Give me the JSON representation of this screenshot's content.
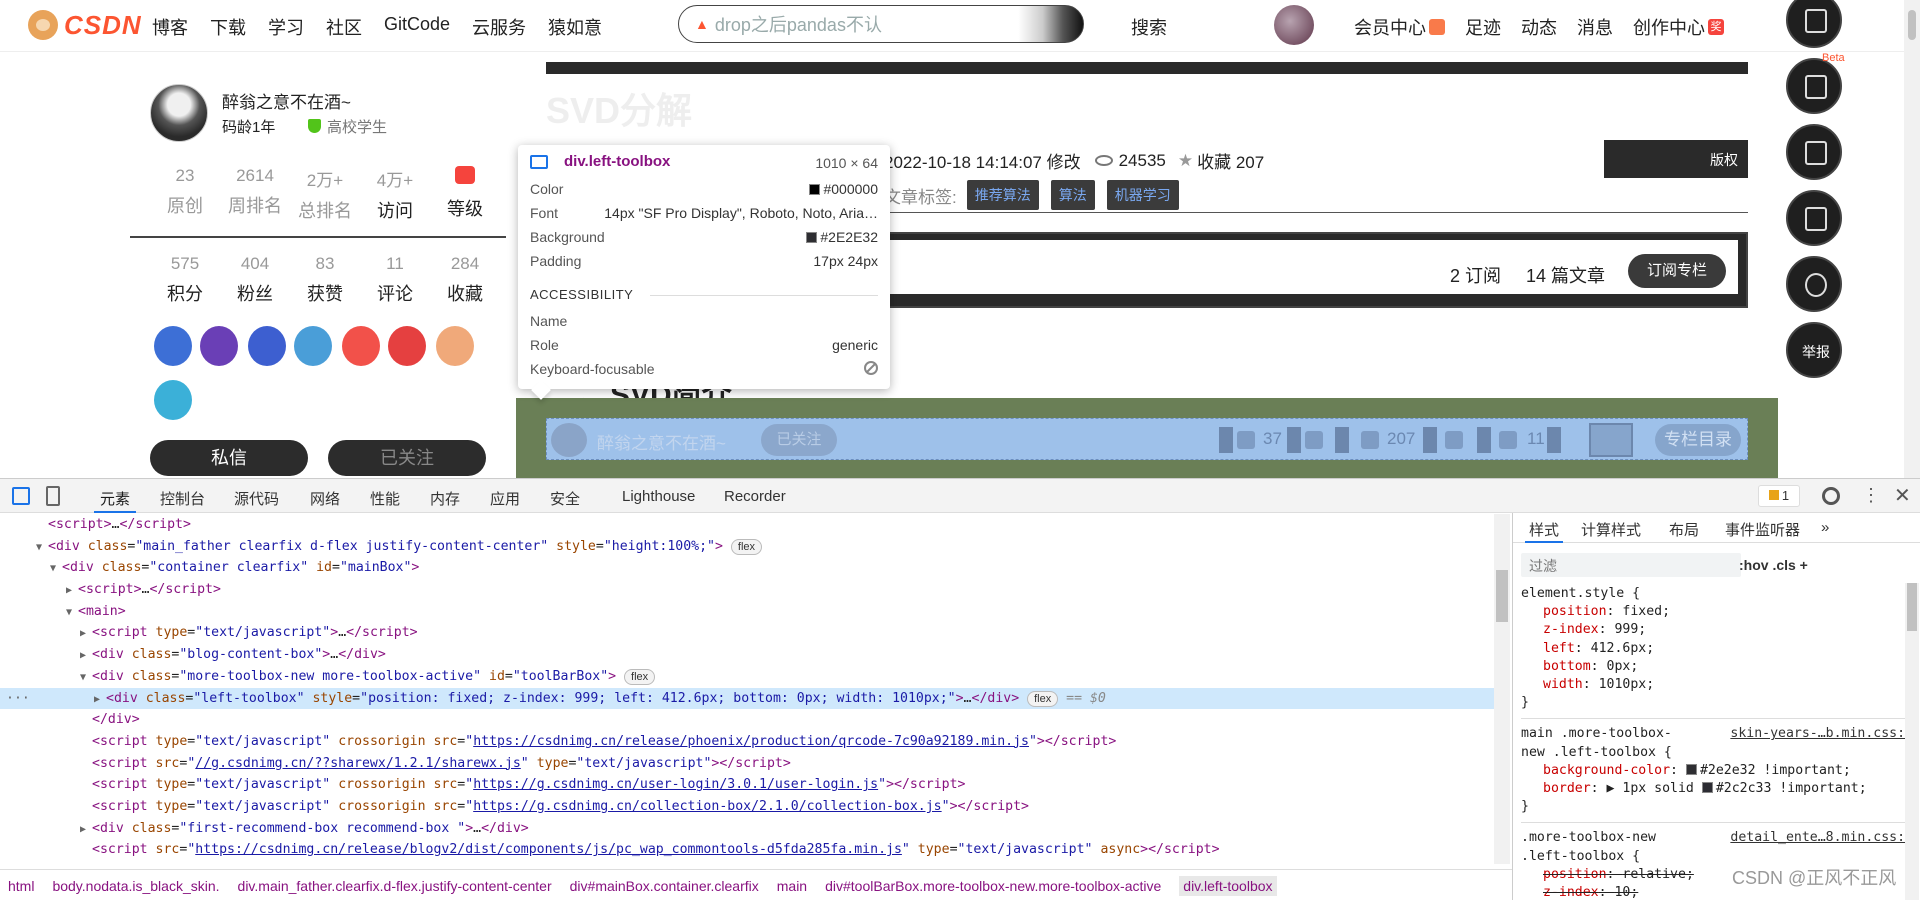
{
  "nav": {
    "logo_text": "CSDN",
    "links": [
      "博客",
      "下载",
      "学习",
      "社区",
      "GitCode",
      "云服务",
      "猿如意"
    ],
    "search_placeholder": "drop之后pandas不认",
    "search_button": "搜索",
    "right_links": [
      "会员中心",
      "足迹",
      "动态",
      "消息",
      "创作中心"
    ]
  },
  "right_tools": {
    "beta_label": "Beta",
    "report_label": "举报"
  },
  "sidebar": {
    "username": "醉翁之意不在酒~",
    "code_age": "码龄1年",
    "school": "高校学生",
    "stats_row1": [
      {
        "num": "23",
        "label": "原创"
      },
      {
        "num": "2614",
        "label": "周排名"
      },
      {
        "num": "2万+",
        "label": "总排名"
      },
      {
        "num": "4万+",
        "label": "访问"
      },
      {
        "num": "",
        "label": "等级"
      }
    ],
    "stats_row2": [
      {
        "num": "575",
        "label": "积分"
      },
      {
        "num": "404",
        "label": "粉丝"
      },
      {
        "num": "83",
        "label": "获赞"
      },
      {
        "num": "11",
        "label": "评论"
      },
      {
        "num": "284",
        "label": "收藏"
      }
    ],
    "badge_colors": [
      "#3d6fd6",
      "#6a3fb6",
      "#3d5fd0",
      "#4a9ed8",
      "#f2514a",
      "#e54040",
      "#f0a97a",
      "#3bb0d8"
    ],
    "message_button": "私信",
    "follow_button": "已关注"
  },
  "article": {
    "title": "SVD分解",
    "modified": "2022-10-18 14:14:07 修改",
    "views": "24535",
    "favorites": "收藏 207",
    "copyright": "版权",
    "tags_label": "文章标签:",
    "tags": [
      "推荐算法",
      "算法",
      "机器学习"
    ],
    "column_subscribe_count": "2 订阅",
    "column_article_count": "14 篇文章",
    "column_subscribe_button": "订阅专栏",
    "section_heading": "、SVD简介"
  },
  "toolbox": {
    "name": "醉翁之意不在酒~",
    "followed": "已关注",
    "likes": "37",
    "favorites": "207",
    "comments": "11",
    "catalog": "专栏目录"
  },
  "tooltip": {
    "selector": "div.left-toolbox",
    "size": "1010 × 64",
    "rows": [
      {
        "k": "Color",
        "v": "#000000",
        "swatch": "#000000"
      },
      {
        "k": "Font",
        "v": "14px \"SF Pro Display\", Roboto, Noto, Aria…"
      },
      {
        "k": "Background",
        "v": "#2E2E32",
        "swatch": "#2E2E32"
      },
      {
        "k": "Padding",
        "v": "17px 24px"
      }
    ],
    "accessibility_title": "ACCESSIBILITY",
    "a11y": [
      {
        "k": "Name",
        "v": ""
      },
      {
        "k": "Role",
        "v": "generic"
      },
      {
        "k": "Keyboard-focusable",
        "v": ""
      }
    ]
  },
  "devtools": {
    "tabs": [
      "元素",
      "控制台",
      "源代码",
      "网络",
      "性能",
      "内存",
      "应用",
      "安全",
      "Lighthouse",
      "Recorder"
    ],
    "issues_count": "1",
    "styles_tabs": [
      "样式",
      "计算样式",
      "布局",
      "事件监听器"
    ],
    "filter_placeholder": "过滤",
    "filter_buttons": ":hov  .cls  +",
    "breadcrumbs": [
      "html",
      "body.nodata.is_black_skin.",
      "div.main_father.clearfix.d-flex.justify-content-center",
      "div#mainBox.container.clearfix",
      "main",
      "div#toolBarBox.more-toolbox-new.more-toolbox-active",
      "div.left-toolbox"
    ]
  },
  "watermark": "CSDN @正风不正风"
}
